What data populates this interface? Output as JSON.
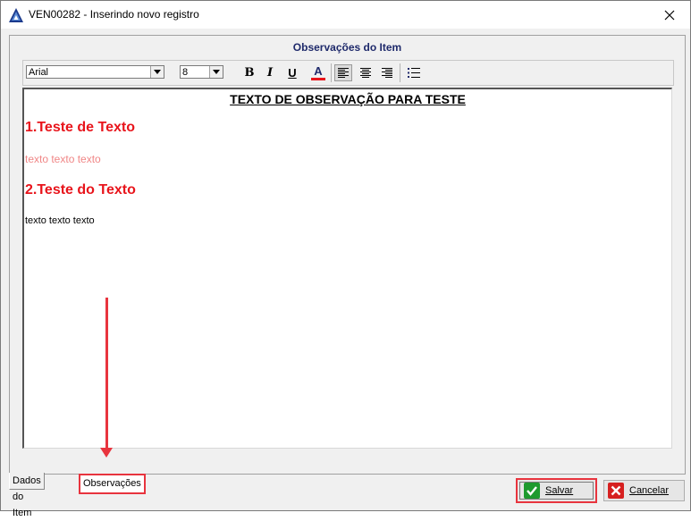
{
  "window": {
    "title": "VEN00282 - Inserindo novo registro",
    "close_glyph": "✕"
  },
  "panel": {
    "caption": "Observações do Item"
  },
  "toolbar": {
    "font_value": "Arial",
    "size_value": "8",
    "bold_label": "B",
    "italic_label": "I",
    "underline_label": "U",
    "font_color_label": "A",
    "font_color": "#e8141b"
  },
  "document": {
    "heading": "TEXTO DE OBSERVAÇÃO PARA TESTE",
    "h1a": "1.Teste de Texto",
    "p1": "texto texto texto",
    "h1b": "2.Teste do Texto",
    "p2": "texto texto texto"
  },
  "tabs": [
    {
      "label": "Dados do Item",
      "active": false
    },
    {
      "label": "Observações",
      "active": true
    }
  ],
  "buttons": {
    "save_label": "Salvar",
    "cancel_label": "Cancelar"
  },
  "colors": {
    "highlight": "#e8343e",
    "heading_red": "#e8141b",
    "pink_text": "#f08686",
    "caption_blue": "#1f2a6b"
  }
}
